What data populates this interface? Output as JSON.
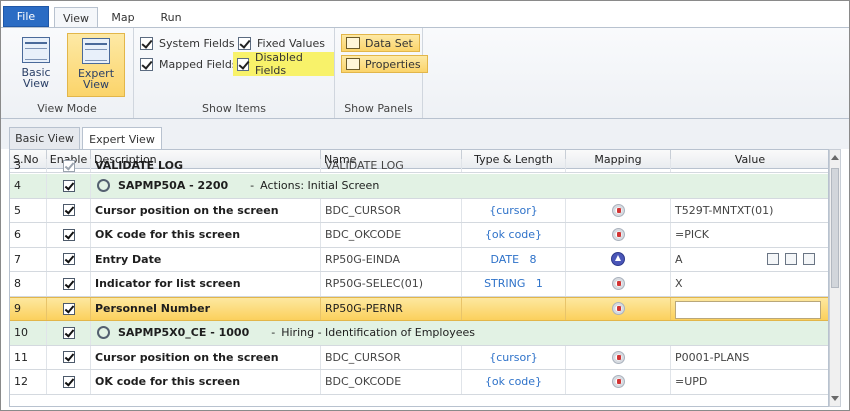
{
  "ribbon_tabs": {
    "file": "File",
    "view": "View",
    "map": "Map",
    "run": "Run"
  },
  "view_mode": {
    "basic": {
      "line1": "Basic",
      "line2": "View"
    },
    "expert": {
      "line1": "Expert",
      "line2": "View"
    },
    "label": "View Mode"
  },
  "show_items": {
    "system_fields": "System Fields",
    "fixed_values": "Fixed Values",
    "mapped_fields": "Mapped Fields",
    "disabled_fields": "Disabled Fields",
    "label": "Show Items"
  },
  "show_panels": {
    "data_set": "Data Set",
    "properties": "Properties",
    "label": "Show Panels"
  },
  "doc_tabs": {
    "basic": "Basic View",
    "expert": "Expert View"
  },
  "columns": {
    "sno": "S.No",
    "enable": "Enable",
    "description": "Description",
    "name": "Name",
    "type": "Type & Length",
    "mapping": "Mapping",
    "value": "Value"
  },
  "rows": [
    {
      "sno": "3",
      "description": "VALIDATE LOG",
      "name": "VALIDATE LOG",
      "type": "",
      "value": ""
    },
    {
      "sno": "4",
      "title": "SAPMP50A - 2200",
      "subtitle": "Actions: Initial Screen"
    },
    {
      "sno": "5",
      "description": "Cursor position on the screen",
      "name": "BDC_CURSOR",
      "type": "{cursor}",
      "value": "T529T-MNTXT(01)"
    },
    {
      "sno": "6",
      "description": "OK code for this screen",
      "name": "BDC_OKCODE",
      "type": "{ok code}",
      "value": "=PICK"
    },
    {
      "sno": "7",
      "description": "Entry Date",
      "name": "RP50G-EINDA",
      "type": "DATE   8",
      "value": "A"
    },
    {
      "sno": "8",
      "description": "Indicator for list screen",
      "name": "RP50G-SELEC(01)",
      "type": "STRING   1",
      "value": "X"
    },
    {
      "sno": "9",
      "description": "Personnel Number",
      "name": "RP50G-PERNR",
      "type": "",
      "value": ""
    },
    {
      "sno": "10",
      "title": "SAPMP5X0_CE - 1000",
      "subtitle": "Hiring - Identification of Employees"
    },
    {
      "sno": "11",
      "description": "Cursor position on the screen",
      "name": "BDC_CURSOR",
      "type": "{cursor}",
      "value": "P0001-PLANS"
    },
    {
      "sno": "12",
      "description": "OK code for this screen",
      "name": "BDC_OKCODE",
      "type": "{ok code}",
      "value": "=UPD"
    }
  ],
  "section_separator": "-"
}
